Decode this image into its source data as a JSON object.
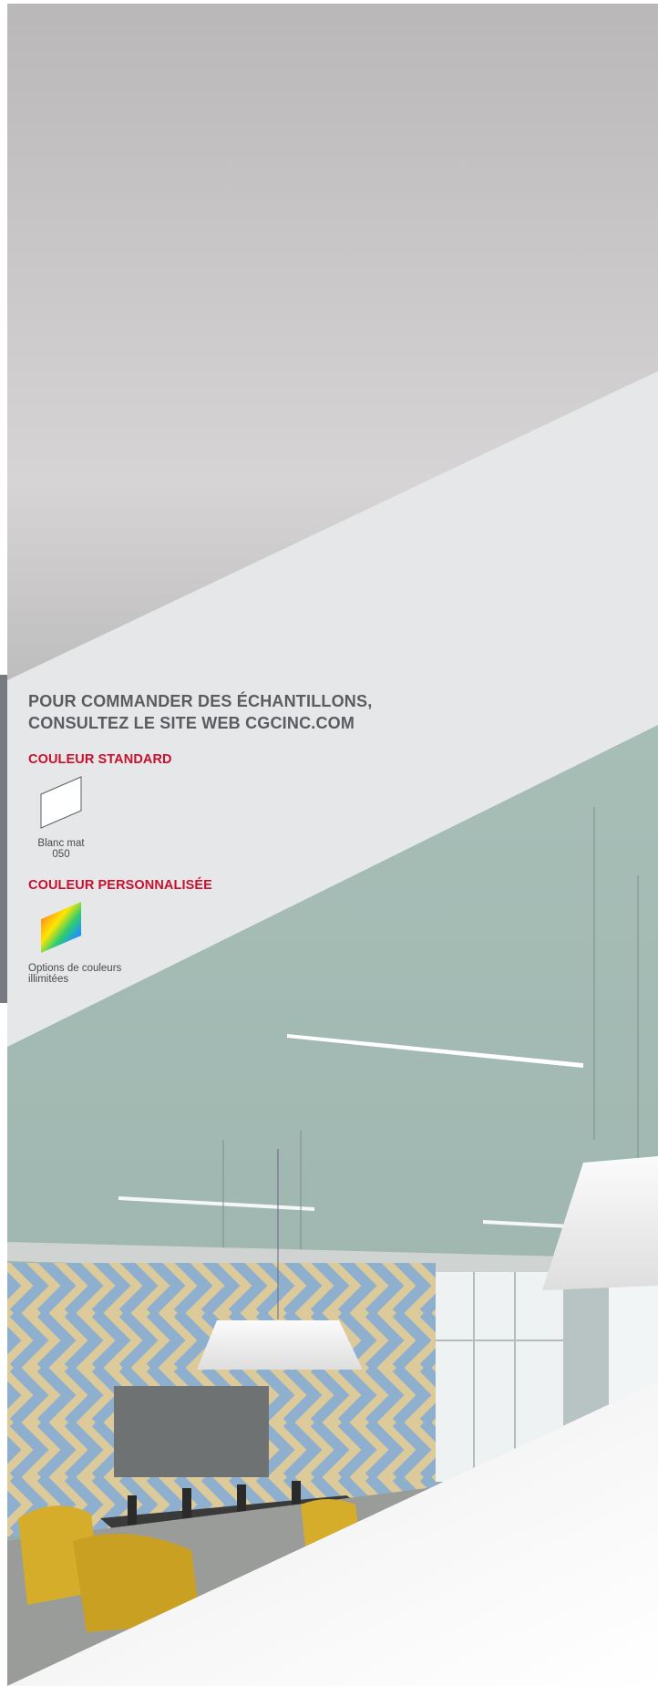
{
  "headline": {
    "line1": "POUR COMMANDER DES ÉCHANTILLONS,",
    "line2": "CONSULTEZ LE SITE WEB CGCINC.COM"
  },
  "standard_color": {
    "title": "COULEUR STANDARD",
    "swatch_icon": "white-swatch-icon",
    "swatch_color": "#ffffff",
    "name": "Blanc mat",
    "code": "050"
  },
  "custom_color": {
    "title": "COULEUR PERSONNALISÉE",
    "swatch_icon": "rainbow-swatch-icon",
    "label_line1": "Options de couleurs",
    "label_line2": "illimitées"
  },
  "colors": {
    "accent_red": "#c8102e",
    "panel_gray": "#e6e7e8",
    "text_gray": "#5b5c60"
  }
}
